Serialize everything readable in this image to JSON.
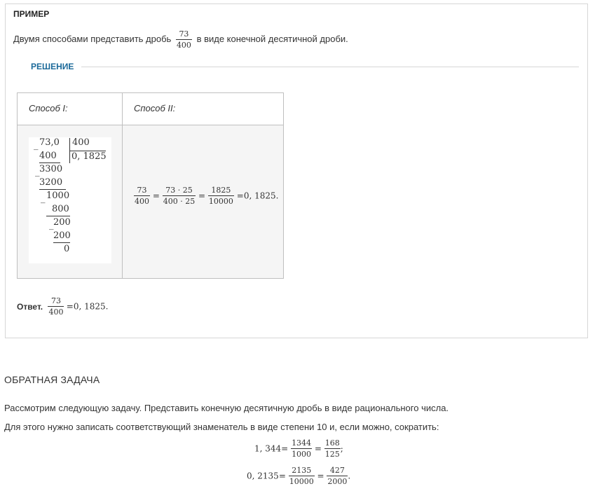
{
  "example": {
    "label": "ПРИМЕР",
    "task_before": "Двумя способами представить дробь",
    "task_frac": {
      "num": "73",
      "den": "400"
    },
    "task_after": "в виде конечной десятичной дроби.",
    "solution_label": "РЕШЕНИЕ",
    "method1_title": "Способ I:",
    "method2_title": "Способ II:",
    "long_division": {
      "dividend": "73,0",
      "divisor": "400",
      "sub1": "400",
      "quotient": "0, 1825",
      "rem1": "3300",
      "sub2": "3200",
      "rem2": "1000",
      "sub3": "800",
      "rem3": "200",
      "sub4": "200",
      "final": "0",
      "minus": "_"
    },
    "method2": {
      "f1": {
        "num": "73",
        "den": "400"
      },
      "f2": {
        "num": "73 · 25",
        "den": "400 · 25"
      },
      "f3": {
        "num": "1825",
        "den": "10000"
      },
      "eq": "=",
      "result": "0, 1825."
    },
    "answer": {
      "label": "Ответ.",
      "frac": {
        "num": "73",
        "den": "400"
      },
      "eq": "=",
      "value": "0, 1825."
    }
  },
  "inverse": {
    "title": "ОБРАТНАЯ ЗАДАЧА",
    "p1": "Рассмотрим следующую задачу. Представить конечную десятичную дробь в виде рационального числа.",
    "p2": "Для этого нужно записать соответствующий знаменатель в виде степени 10 и, если можно, сократить:",
    "eq1": {
      "left": "1, 344",
      "eq": "=",
      "f1": {
        "num": "1344",
        "den": "1000"
      },
      "f2": {
        "num": "168",
        "den": "125"
      },
      "end": ";"
    },
    "eq2": {
      "left": "0, 2135",
      "eq": "=",
      "f1": {
        "num": "2135",
        "den": "10000"
      },
      "f2": {
        "num": "427",
        "den": "2000"
      },
      "end": "."
    }
  }
}
